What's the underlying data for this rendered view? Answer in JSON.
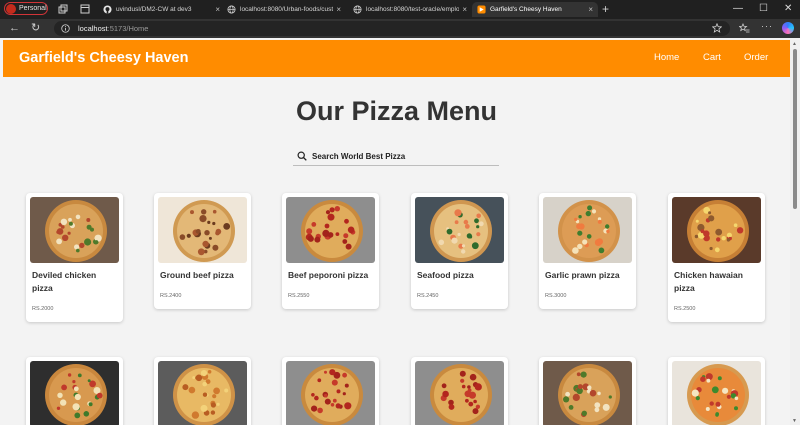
{
  "browser": {
    "profile_label": "Personal",
    "tabs": [
      {
        "title": "uvindusl/DM2-CW at dev3",
        "icon": "github-icon",
        "active": false
      },
      {
        "title": "localhost:8080/Urban-foods/cust",
        "icon": "globe-icon",
        "active": false
      },
      {
        "title": "localhost:8080/test-oracle/emplo",
        "icon": "globe-icon",
        "active": false
      },
      {
        "title": "Garfield's Cheesy Haven",
        "icon": "site-favicon",
        "active": true
      }
    ],
    "close_glyph": "×",
    "new_tab_glyph": "+",
    "url_host": "localhost",
    "url_path": ":5173/Home",
    "window_controls": {
      "minimize": "—",
      "maximize": "☐",
      "close": "✕"
    },
    "more_glyph": "···"
  },
  "site": {
    "brand": "Garfield's Cheesy Haven",
    "nav": [
      "Home",
      "Cart",
      "Order"
    ],
    "accent_color": "#ff8c00",
    "heading": "Our Pizza Menu",
    "search_placeholder": "Search World Best Pizza"
  },
  "menu": {
    "items": [
      {
        "name": "Deviled chicken pizza",
        "price": "RS.2000",
        "topping": "chicken"
      },
      {
        "name": "Ground beef pizza",
        "price": "RS.2400",
        "topping": "beef"
      },
      {
        "name": "Beef peporoni pizza",
        "price": "RS.2550",
        "topping": "pepperoni"
      },
      {
        "name": "Seafood pizza",
        "price": "RS.2450",
        "topping": "seafood"
      },
      {
        "name": "Garlic prawn pizza",
        "price": "RS.3000",
        "topping": "prawn"
      },
      {
        "name": "Chicken hawaian pizza",
        "price": "RS.2500",
        "topping": "hawaiian"
      }
    ],
    "second_row_toppings": [
      "veggie",
      "cheese",
      "pepperoni",
      "pepperoni",
      "chicken",
      "margherita"
    ]
  }
}
